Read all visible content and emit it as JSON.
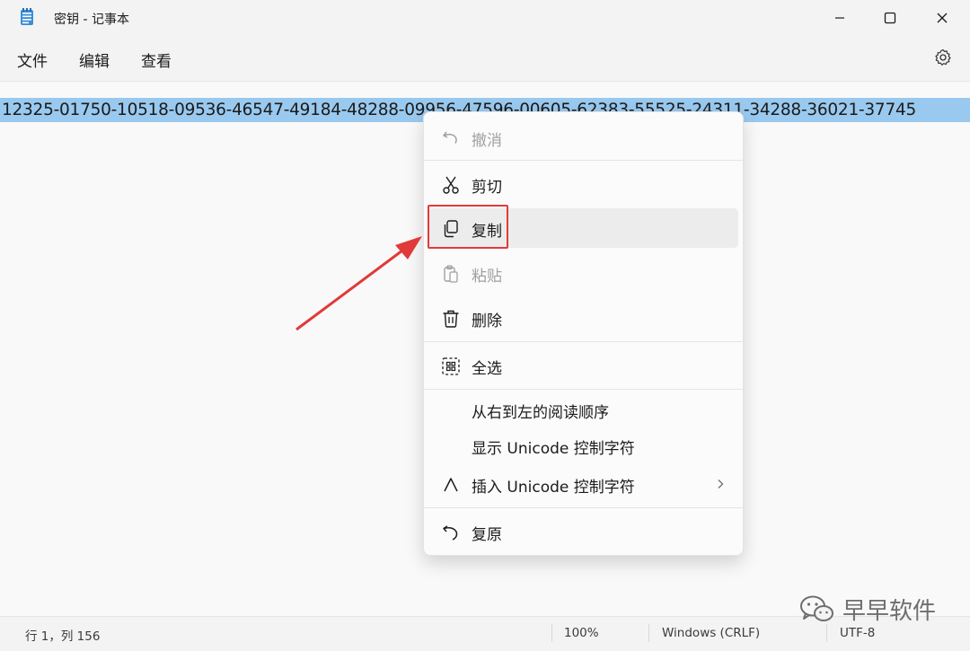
{
  "window": {
    "title": "密钥 - 记事本"
  },
  "menubar": {
    "file": "文件",
    "edit": "编辑",
    "view": "查看"
  },
  "editor": {
    "selected_text": "12325-01750-10518-09536-46547-49184-48288-09956-47596-00605-62383-55525-24311-34288-36021-37745"
  },
  "context_menu": {
    "undo": "撤消",
    "cut": "剪切",
    "copy": "复制",
    "paste": "粘贴",
    "delete": "删除",
    "select_all": "全选",
    "rtl": "从右到左的阅读顺序",
    "show_unicode": "显示 Unicode 控制字符",
    "insert_unicode": "插入 Unicode 控制字符",
    "reconvert": "复原"
  },
  "statusbar": {
    "position": "行 1，列 156",
    "zoom": "100%",
    "line_ending": "Windows (CRLF)",
    "encoding": "UTF-8"
  },
  "watermark": {
    "text": "早早软件"
  },
  "colors": {
    "selection": "#99c9ef",
    "highlight_box": "#e13a3a"
  }
}
